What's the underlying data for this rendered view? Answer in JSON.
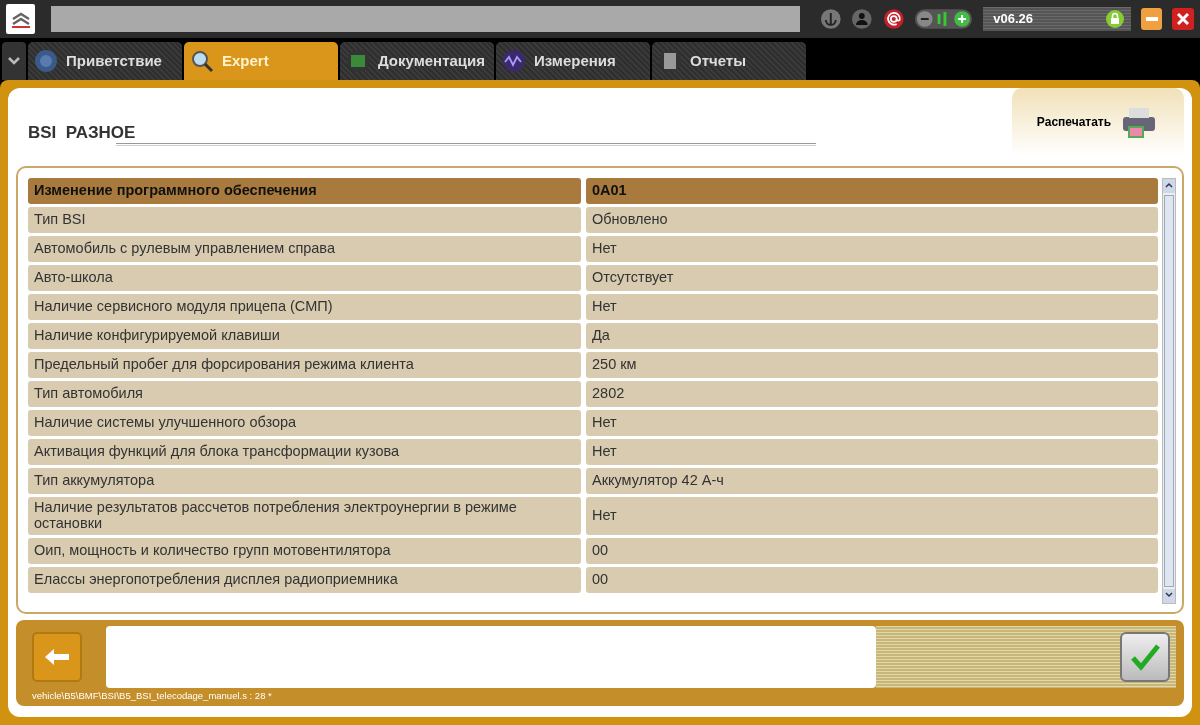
{
  "top_bar": {
    "version": "v06.26"
  },
  "tabs": [
    {
      "label": "Приветствие",
      "selected": false
    },
    {
      "label": "Expert",
      "selected": true
    },
    {
      "label": "Документация",
      "selected": false
    },
    {
      "label": "Измерения",
      "selected": false
    },
    {
      "label": "Отчеты",
      "selected": false
    }
  ],
  "page": {
    "title": "BSI  РАЗНОЕ",
    "print_button": "Распечатать"
  },
  "table": {
    "rows": [
      {
        "parameter": "Изменение программного обеспечения",
        "value": "0A01",
        "selected": true
      },
      {
        "parameter": "Тип BSI",
        "value": "Обновлено",
        "selected": false
      },
      {
        "parameter": "Автомобиль с рулевым управлением справа",
        "value": "Нет",
        "selected": false
      },
      {
        "parameter": "Авто-школа",
        "value": "Отсутствует",
        "selected": false
      },
      {
        "parameter": "Наличие сервисного модуля прицепа (СМП)",
        "value": "Нет",
        "selected": false
      },
      {
        "parameter": "Наличие конфигурируемой клавиши",
        "value": "Да",
        "selected": false
      },
      {
        "parameter": "Предельный пробег для форсирования режима клиента",
        "value": "250 км",
        "selected": false
      },
      {
        "parameter": "Тип автомобиля",
        "value": "2802",
        "selected": false
      },
      {
        "parameter": "Наличие системы улучшенного обзора",
        "value": "Нет",
        "selected": false
      },
      {
        "parameter": "Активация функций для блока трансформации кузова",
        "value": "Нет",
        "selected": false
      },
      {
        "parameter": "Тип аккумулятора",
        "value": "Аккумулятор 42 А-ч",
        "selected": false
      },
      {
        "parameter": "Наличие результатов рассчетов потребления электроунергии в режиме остановки",
        "value": "Нет",
        "selected": false
      },
      {
        "parameter": "Оип, мощность и количество групп мотовентилятора",
        "value": "00",
        "selected": false
      },
      {
        "parameter": "Елассы энергопотребления дисплея радиоприемника",
        "value": "00",
        "selected": false
      }
    ]
  },
  "status_bar": {
    "path": "vehicle\\B5\\BMF\\BSI\\B5_BSI_telecodage_manuel.s : 28 *"
  }
}
